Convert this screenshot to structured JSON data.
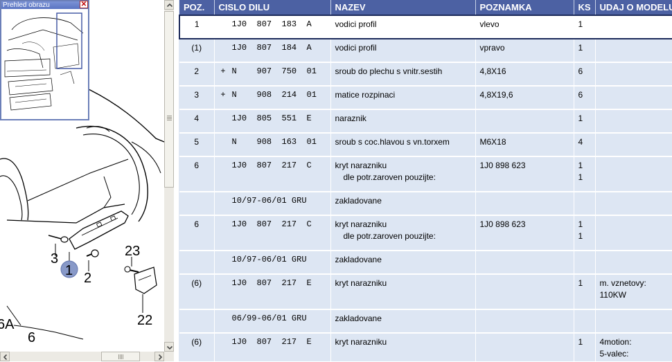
{
  "overview": {
    "title": "Prehled obrazu",
    "close_glyph": "✕"
  },
  "diagram": {
    "callouts": [
      "3",
      "1",
      "2",
      "23",
      "22",
      "6A",
      "6"
    ],
    "selected_callout": "1"
  },
  "table": {
    "headers": [
      "POZ.",
      "CISLO DILU",
      "NAZEV",
      "POZNAMKA",
      "KS",
      "UDAJ O MODELU"
    ],
    "rows": [
      {
        "pos": "1",
        "prefix": "",
        "number": "1J0  807  183  A",
        "name": [
          "vodici profil"
        ],
        "note": [
          "vlevo"
        ],
        "qty": [
          "1"
        ],
        "model": [],
        "selected": true
      },
      {
        "pos": "(1)",
        "prefix": "",
        "number": "1J0  807  184  A",
        "name": [
          "vodici profil"
        ],
        "note": [
          "vpravo"
        ],
        "qty": [
          "1"
        ],
        "model": []
      },
      {
        "pos": "2",
        "prefix": "+",
        "number": "N    907  750  01",
        "name": [
          "sroub do plechu s vnitr.sestih"
        ],
        "note": [
          "4,8X16"
        ],
        "qty": [
          "6"
        ],
        "model": []
      },
      {
        "pos": "3",
        "prefix": "+",
        "number": "N    908  214  01",
        "name": [
          "matice rozpinaci"
        ],
        "note": [
          "4,8X19,6"
        ],
        "qty": [
          "6"
        ],
        "model": []
      },
      {
        "pos": "4",
        "prefix": "",
        "number": "1J0  805  551  E",
        "name": [
          "naraznik"
        ],
        "note": [],
        "qty": [
          "1"
        ],
        "model": []
      },
      {
        "pos": "5",
        "prefix": "",
        "number": "N    908  163  01",
        "name": [
          "sroub s coc.hlavou s vn.torxem"
        ],
        "note": [
          "M6X18"
        ],
        "qty": [
          "4"
        ],
        "model": []
      },
      {
        "pos": "6",
        "prefix": "",
        "number": "1J0  807  217  C",
        "name": [
          "kryt narazniku",
          "dle potr.zaroven pouzijte:"
        ],
        "note": [
          "",
          "1J0 898 623"
        ],
        "qty": [
          "1",
          "1"
        ],
        "model": []
      },
      {
        "pos": "",
        "prefix": "",
        "number": "10/97-06/01 GRU",
        "name": [
          "zakladovane"
        ],
        "note": [],
        "qty": [],
        "model": []
      },
      {
        "pos": "6",
        "prefix": "",
        "number": "1J0  807  217  C",
        "name": [
          "kryt narazniku",
          "dle potr.zaroven pouzijte:"
        ],
        "note": [
          "",
          "1J0 898 623"
        ],
        "qty": [
          "1",
          "1"
        ],
        "model": []
      },
      {
        "pos": "",
        "prefix": "",
        "number": "10/97-06/01 GRU",
        "name": [
          "zakladovane"
        ],
        "note": [],
        "qty": [],
        "model": []
      },
      {
        "pos": "(6)",
        "prefix": "",
        "number": "1J0  807  217  E",
        "name": [
          "kryt narazniku"
        ],
        "note": [],
        "qty": [
          "1"
        ],
        "model": [
          "m. vznetovy:",
          "110KW"
        ]
      },
      {
        "pos": "",
        "prefix": "",
        "number": "06/99-06/01 GRU",
        "name": [
          "zakladovane"
        ],
        "note": [],
        "qty": [],
        "model": []
      },
      {
        "pos": "(6)",
        "prefix": "",
        "number": "1J0  807  217  E",
        "name": [
          "kryt narazniku"
        ],
        "note": [],
        "qty": [
          "1"
        ],
        "model": [
          "4motion:",
          "5-valec:"
        ]
      }
    ]
  },
  "colors": {
    "header_bg": "#4c61a3",
    "table_bg": "#dde6f3",
    "selected_border": "#1c2a5a"
  }
}
